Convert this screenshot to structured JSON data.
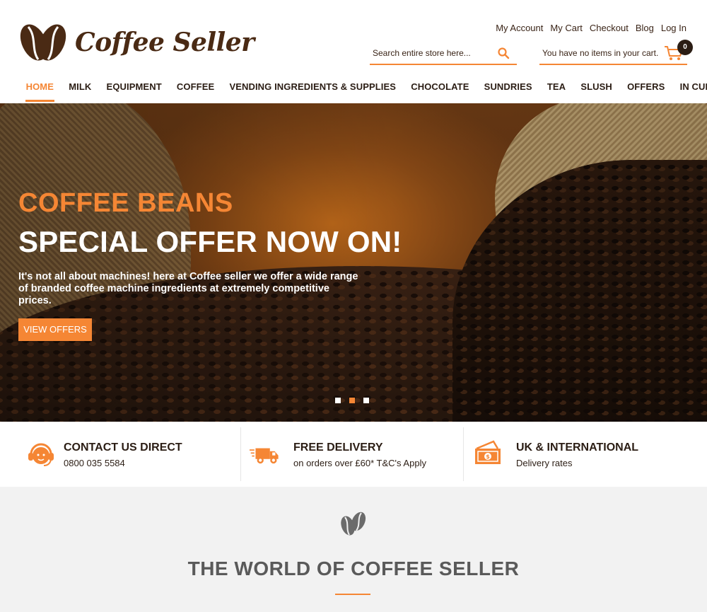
{
  "brand": {
    "name": "Coffee Seller",
    "accent": "#f58634",
    "dark": "#2b1d14"
  },
  "toplinks": [
    "My Account",
    "My Cart",
    "Checkout",
    "Blog",
    "Log In"
  ],
  "search": {
    "placeholder": "Search entire store here...",
    "icon": "search-icon"
  },
  "cart": {
    "message": "You have no items in your cart.",
    "count": "0",
    "icon": "cart-icon"
  },
  "nav": [
    "HOME",
    "MILK",
    "EQUIPMENT",
    "COFFEE",
    "VENDING INGREDIENTS & SUPPLIES",
    "CHOCOLATE",
    "SUNDRIES",
    "TEA",
    "SLUSH",
    "OFFERS",
    "IN CUP"
  ],
  "nav_active": "HOME",
  "hero": {
    "kicker": "COFFEE BEANS",
    "headline": "SPECIAL OFFER NOW ON!",
    "body": "It's not all about machines! here at Coffee seller we offer a wide range of branded coffee machine ingredients at extremely competitive prices.",
    "cta": "VIEW OFFERS",
    "slides": 3,
    "active_slide": 2
  },
  "features": [
    {
      "title": "CONTACT US DIRECT",
      "subtitle": "0800 035 5584",
      "icon": "headset-icon"
    },
    {
      "title": "FREE DELIVERY",
      "subtitle": "on orders over £60* T&C's Apply",
      "icon": "delivery-truck-icon"
    },
    {
      "title": "UK & INTERNATIONAL",
      "subtitle": "Delivery rates",
      "icon": "money-icon"
    }
  ],
  "world": {
    "title": "THE WORLD OF COFFEE SELLER",
    "icon": "coffee-beans-icon"
  }
}
